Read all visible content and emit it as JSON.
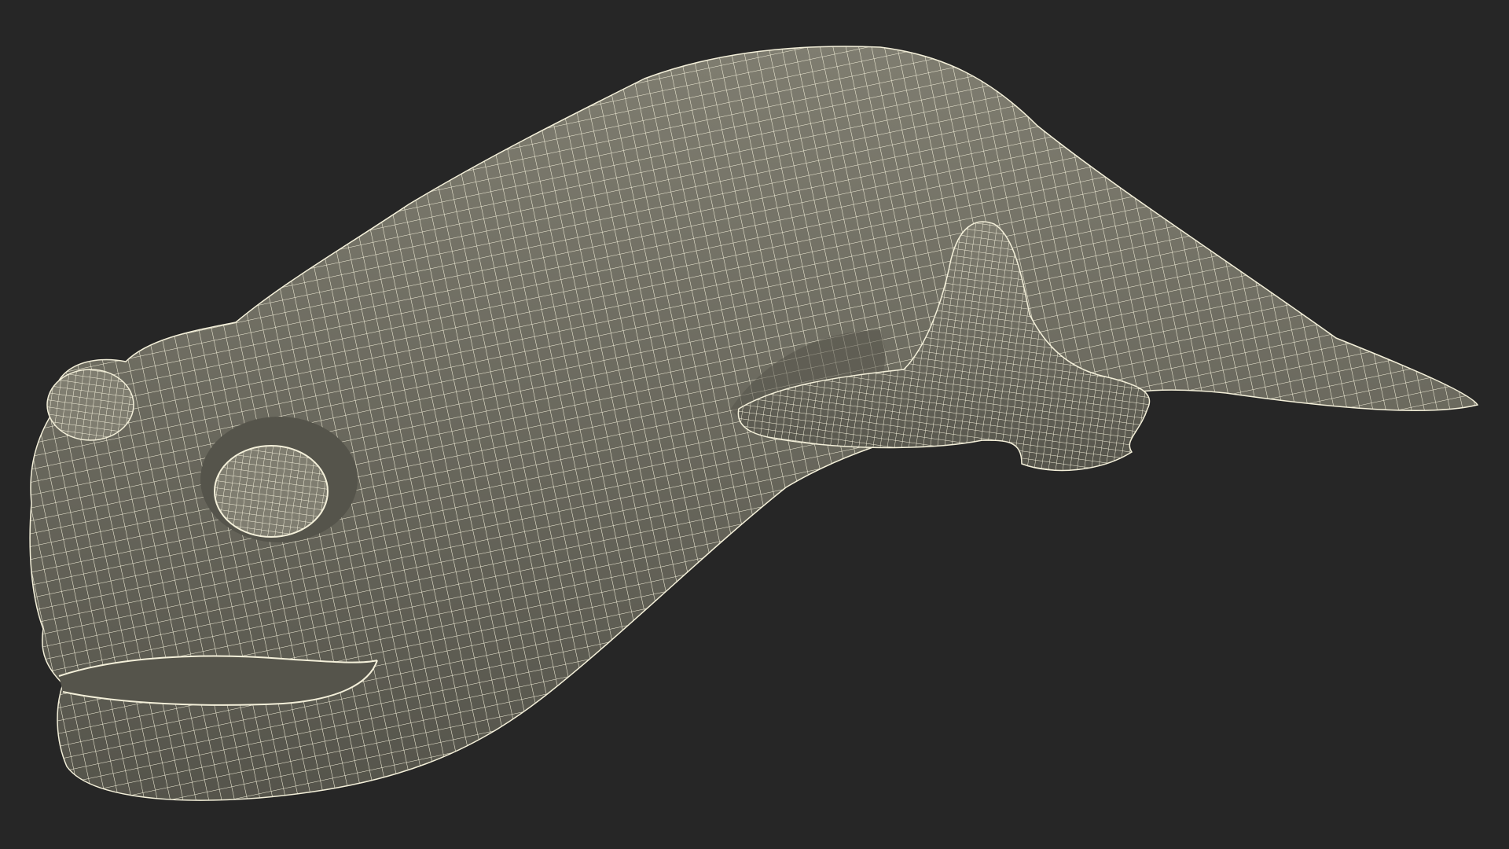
{
  "scene": {
    "subject": "wireframe-creature-model",
    "background_color": "#262626",
    "surface_color": "#7f7d70",
    "surface_shadow_color": "#55544b",
    "wire_color": "#f4f0da",
    "shading": "smooth-with-wireframe-overlay"
  }
}
